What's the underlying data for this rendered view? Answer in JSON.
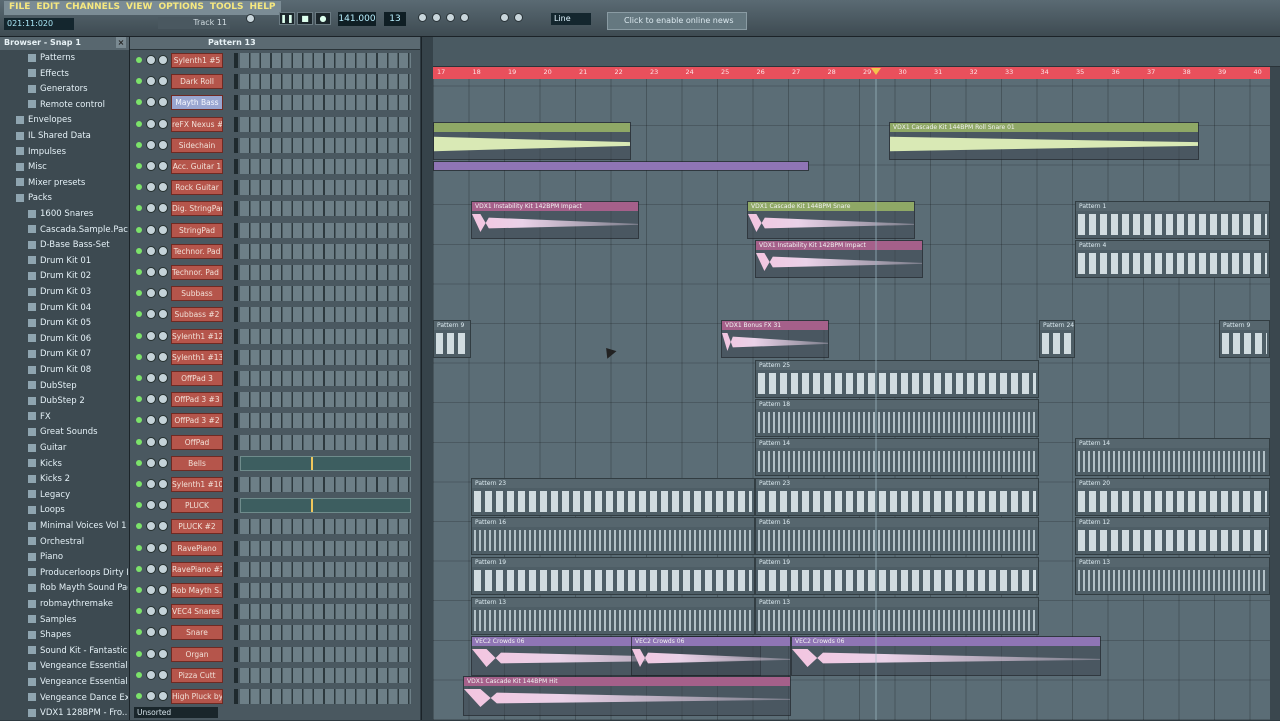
{
  "menu": [
    "FILE",
    "EDIT",
    "CHANNELS",
    "VIEW",
    "OPTIONS",
    "TOOLS",
    "HELP"
  ],
  "time": "021:11:020",
  "hint": "Track 11",
  "lcd": "141.000",
  "lcd2": "13",
  "snap": "Line",
  "news": "Click to enable online news",
  "browser_title": "Browser - Snap 1",
  "browser": [
    "Patterns",
    "Effects",
    "Generators",
    "Remote control",
    "Envelopes",
    "IL Shared Data",
    "Impulses",
    "Misc",
    "Mixer presets",
    "Packs",
    "1600 Snares",
    "Cascada.Sample.Pac...",
    "D-Base Bass-Set",
    "Drum Kit 01",
    "Drum Kit 02",
    "Drum Kit 03",
    "Drum Kit 04",
    "Drum Kit 05",
    "Drum Kit 06",
    "Drum Kit 07",
    "Drum Kit 08",
    "DubStep",
    "DubStep 2",
    "FX",
    "Great Sounds",
    "Guitar",
    "Kicks",
    "Kicks 2",
    "Legacy",
    "Loops",
    "Minimal Voices Vol 1",
    "Orchestral",
    "Piano",
    "Producerloops Dirty K...",
    "Rob Mayth Sound Pack",
    "robmaythremake",
    "Samples",
    "Shapes",
    "Sound Kit - Fantastic F...",
    "Vengeance Essential ...",
    "Vengeance Essential ...",
    "Vengeance Dance Ex...",
    "VDX1 128BPM - Fro..."
  ],
  "rack_title": "Pattern 13",
  "channels": [
    "Sylenth1 #5",
    "Dark Roll",
    "Mayth Bass",
    "reFX Nexus #3",
    "Sidechain",
    "Acc. Guitar 1",
    "Rock Guitar",
    "Dig. StringPad",
    "StringPad",
    "Technor. Pad",
    "Technor. Pad ...",
    "Subbass",
    "Subbass #2",
    "Sylenth1 #12",
    "Sylenth1 #13",
    "OffPad 3",
    "OffPad 3 #3",
    "OffPad 3 #2",
    "OffPad",
    "Bells",
    "Sylenth1 #10",
    "PLUCK",
    "PLUCK #2",
    "RavePiano",
    "RavePiano #2",
    "Rob Mayth S...",
    "VEC4 Snares ...",
    "Snare",
    "Organ",
    "Pizza Cutt",
    "High Pluck by..."
  ],
  "unsorted": "Unsorted",
  "ruler": [
    "17",
    "18",
    "19",
    "20",
    "21",
    "22",
    "23",
    "24",
    "25",
    "26",
    "27",
    "28",
    "29",
    "30",
    "31",
    "32",
    "33",
    "34",
    "35",
    "36",
    "37",
    "38",
    "39",
    "40"
  ],
  "clips": {
    "c1": "VDX1 Cascade Kit 144BPM Roll Snare 01",
    "c2": "VDX1 Instability Kit 142BPM Impact",
    "c3": "VDX1 Cascade Kit 144BPM Snare",
    "c4": "VDX1 Instability Kit 142BPM Impact",
    "c5": "VDX1 Bonus FX 31",
    "c6": "VEC2 Crowds 06",
    "c7": "VEC2 Crowds 06",
    "c8": "VEC2 Crowds 06",
    "c9": "VDX1 Cascade Kit 144BPM Hit",
    "p1": "Pattern 1",
    "p4": "Pattern 4",
    "p9": "Pattern 9",
    "p24": "Pattern 24",
    "p25": "Pattern 25",
    "p18": "Pattern 18",
    "p14": "Pattern 14",
    "p23": "Pattern 23",
    "p20": "Pattern 20",
    "p16": "Pattern 16",
    "p12": "Pattern 12",
    "p19": "Pattern 19",
    "p13": "Pattern 13"
  }
}
